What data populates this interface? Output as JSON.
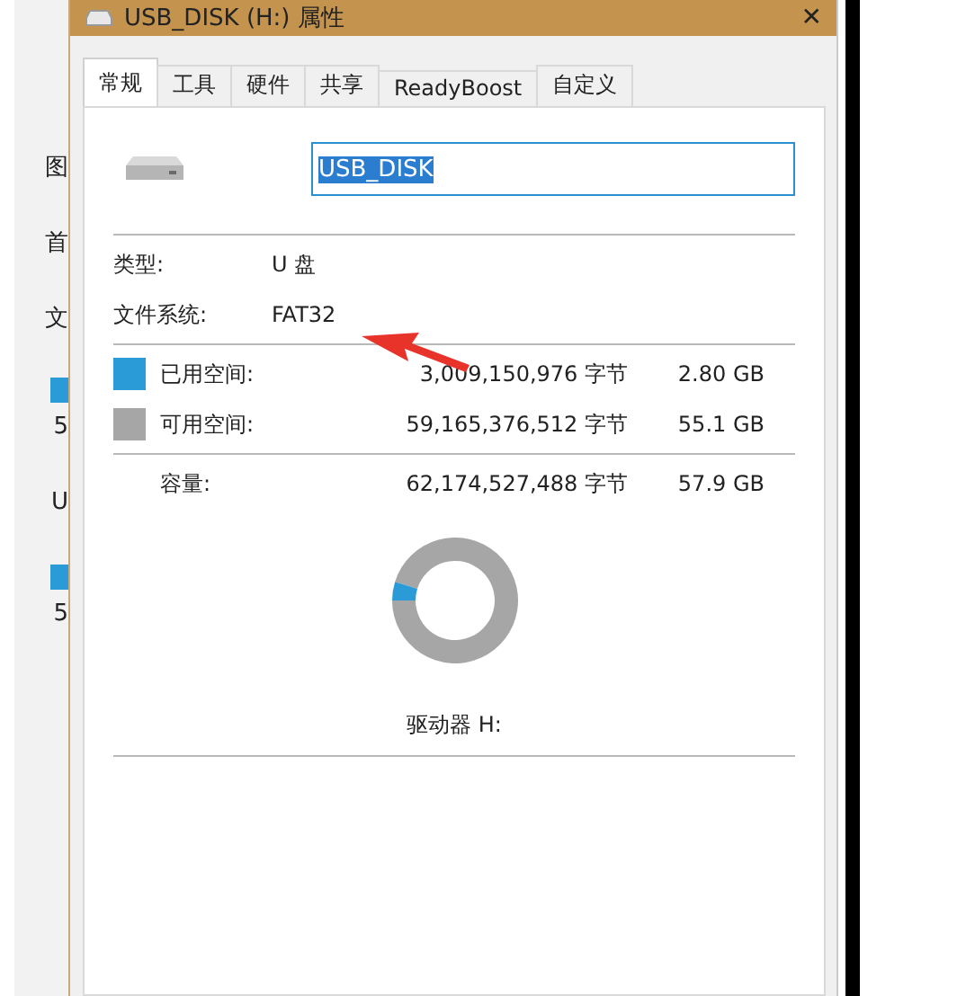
{
  "background_window": {
    "fragments": [
      {
        "kind": "text",
        "text": "图"
      },
      {
        "kind": "text",
        "text": "首"
      },
      {
        "kind": "text",
        "text": "文"
      },
      {
        "kind": "bar",
        "color": "#2b9bd8"
      },
      {
        "kind": "text",
        "text": "5"
      },
      {
        "kind": "text",
        "text": "U"
      },
      {
        "kind": "bar",
        "color": "#2b9bd8"
      },
      {
        "kind": "text",
        "text": "5"
      }
    ]
  },
  "window": {
    "title": "USB_DISK (H:) 属性",
    "close": "✕"
  },
  "tabs": [
    {
      "label": "常规",
      "selected": true
    },
    {
      "label": "工具",
      "selected": false
    },
    {
      "label": "硬件",
      "selected": false
    },
    {
      "label": "共享",
      "selected": false
    },
    {
      "label": "ReadyBoost",
      "selected": false
    },
    {
      "label": "自定义",
      "selected": false
    }
  ],
  "name_field": {
    "value": "USB_DISK"
  },
  "info": [
    {
      "label": "类型:",
      "value": "U 盘"
    },
    {
      "label": "文件系统:",
      "value": "FAT32"
    }
  ],
  "space": [
    {
      "label": "已用空间:",
      "bytes": "3,009,150,976 字节",
      "size": "2.80 GB",
      "color": "#2b9bd8"
    },
    {
      "label": "可用空间:",
      "bytes": "59,165,376,512 字节",
      "size": "55.1 GB",
      "color": "#a6a6a6"
    }
  ],
  "capacity": {
    "label": "容量:",
    "bytes": "62,174,527,488 字节",
    "size": "57.9 GB"
  },
  "usage": {
    "level": 0.048
  },
  "drive_label": "驱动器 H:"
}
